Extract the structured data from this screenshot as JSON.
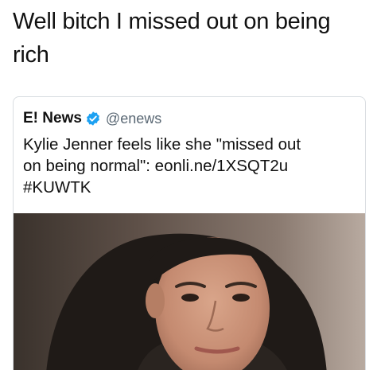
{
  "caption": {
    "line1": "Well bitch I missed out on being",
    "line2": "rich"
  },
  "tweet": {
    "display_name": "E! News",
    "verified_icon": "verified-badge-icon",
    "handle": "@enews",
    "text_line1": "Kylie Jenner feels like she \"missed out",
    "text_line2": "on being normal\": eonli.ne/1XSQT2u",
    "text_line3": "#KUWTK",
    "media": "photo"
  },
  "colors": {
    "verified_blue": "#1da1f2",
    "handle_gray": "#5a6874",
    "card_border": "#d9dde1"
  }
}
